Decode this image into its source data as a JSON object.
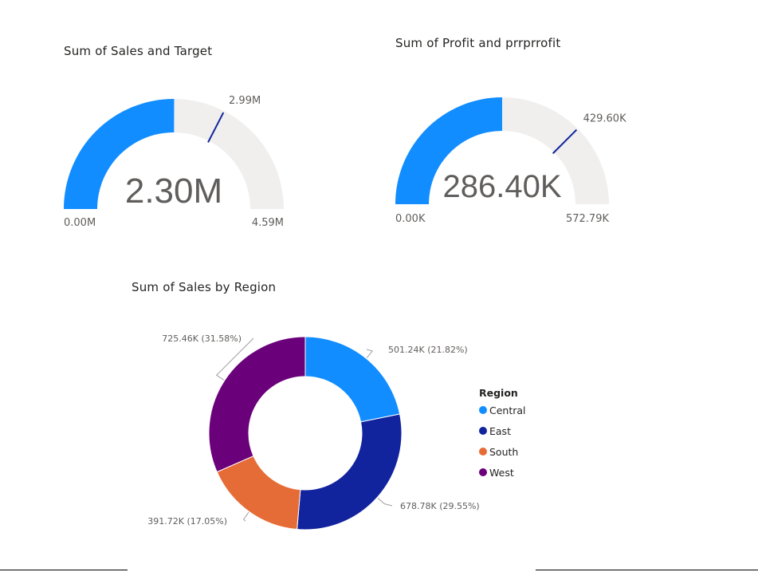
{
  "colors": {
    "gauge_fill": "#118dff",
    "gauge_track": "#f0efee",
    "target_line": "#12239e",
    "central": "#118dff",
    "east": "#12239e",
    "south": "#e66c37",
    "west": "#6b007b"
  },
  "chart_data": [
    {
      "type": "gauge",
      "title": "Sum of Sales and Target",
      "value": 2.3,
      "target": 2.99,
      "min": 0,
      "max": 4.59,
      "unit": "M",
      "value_label": "2.30M",
      "target_label": "2.99M",
      "min_label": "0.00M",
      "max_label": "4.59M"
    },
    {
      "type": "gauge",
      "title": "Sum of Profit and prrprrofit",
      "value": 286.4,
      "target": 429.6,
      "min": 0,
      "max": 572.79,
      "unit": "K",
      "value_label": "286.40K",
      "target_label": "429.60K",
      "min_label": "0.00K",
      "max_label": "572.79K"
    },
    {
      "type": "pie",
      "title": "Sum of Sales by Region",
      "legend_title": "Region",
      "legend_position": "right",
      "series": [
        {
          "name": "Central",
          "value": 501.24,
          "label": "501.24K (21.82%)",
          "color_key": "central"
        },
        {
          "name": "East",
          "value": 678.78,
          "label": "678.78K (29.55%)",
          "color_key": "east"
        },
        {
          "name": "South",
          "value": 391.72,
          "label": "391.72K (17.05%)",
          "color_key": "south"
        },
        {
          "name": "West",
          "value": 725.46,
          "label": "725.46K (31.58%)",
          "color_key": "west"
        }
      ]
    }
  ]
}
